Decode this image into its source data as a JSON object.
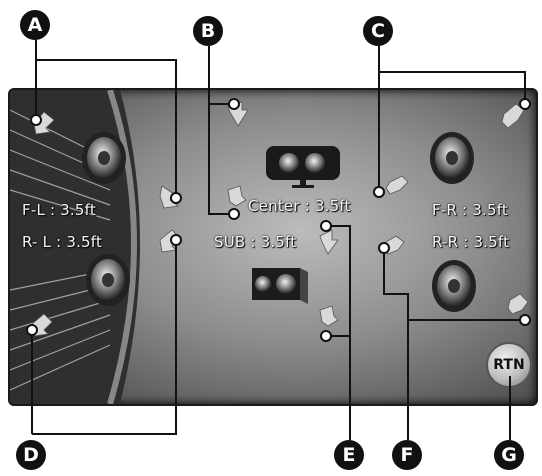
{
  "callouts": {
    "a": "A",
    "b": "B",
    "c": "C",
    "d": "D",
    "e": "E",
    "f": "F",
    "g": "G"
  },
  "speakers": {
    "front_left": "F-L : 3.5ft",
    "rear_left": "R- L : 3.5ft",
    "center": "Center : 3.5ft",
    "subwoofer": "SUB : 3.5ft",
    "front_right": "F-R : 3.5ft",
    "rear_right": "R-R : 3.5ft"
  },
  "buttons": {
    "return": "RTN"
  },
  "icons": {
    "speaker": "speaker-icon",
    "center_speaker": "center-speaker-icon",
    "subwoofer": "subwoofer-icon",
    "arrow": "adjust-arrow-icon"
  },
  "colors": {
    "screen_bg": "#8d8d8d",
    "label_text": "#f4f4f4",
    "badge": "#111111"
  }
}
